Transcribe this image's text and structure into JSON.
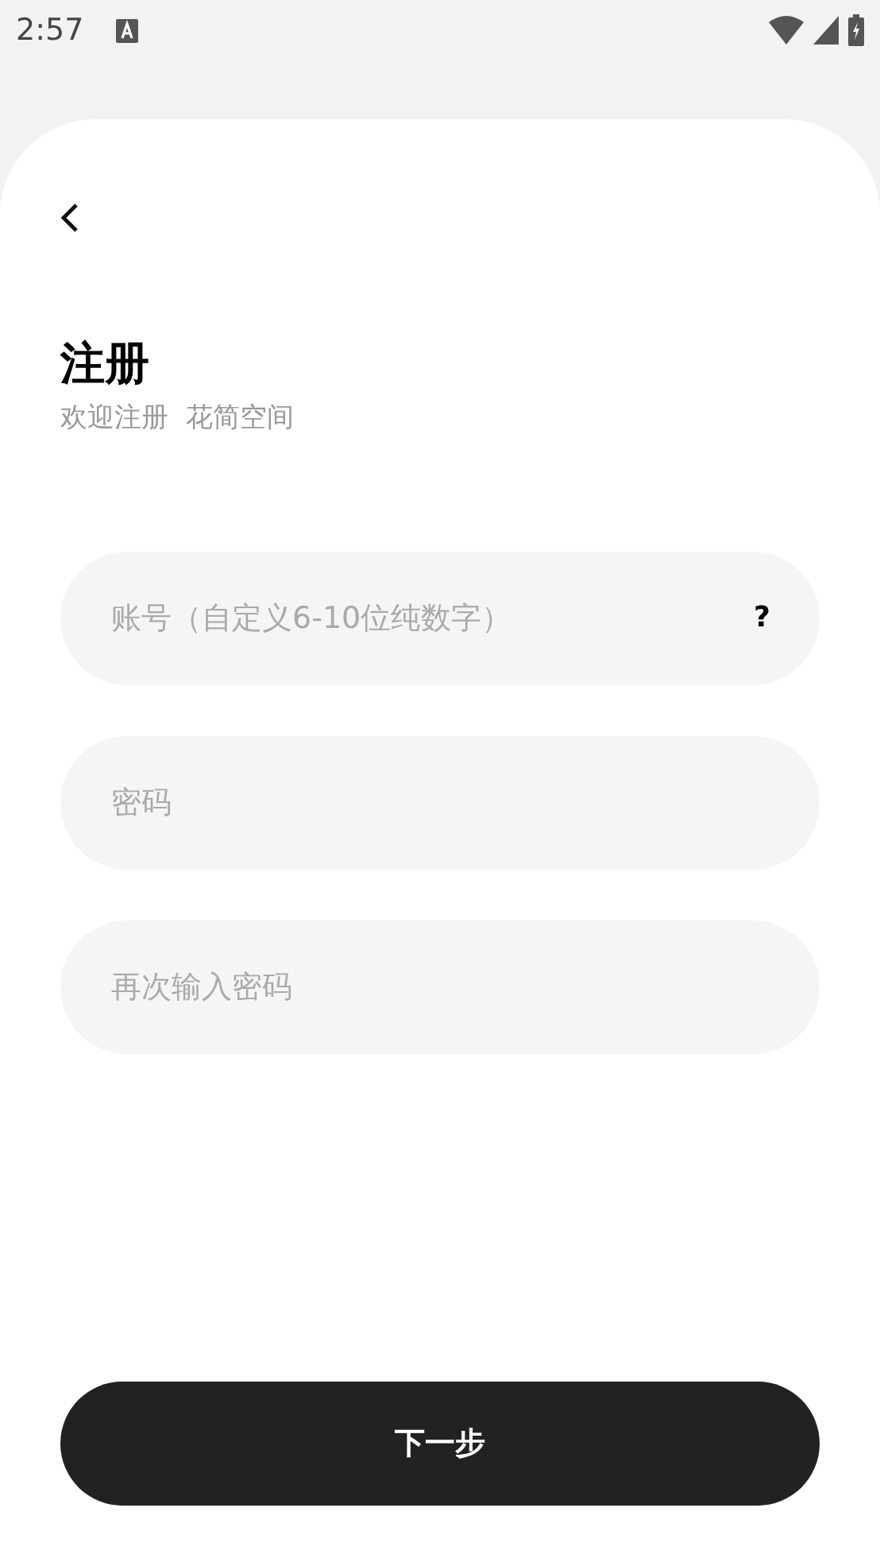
{
  "status_bar": {
    "time": "2:57"
  },
  "header": {
    "title": "注册",
    "subtitle": "欢迎注册  花简空间"
  },
  "fields": [
    {
      "placeholder": "账号（自定义6-10位纯数字）",
      "help": "?"
    },
    {
      "placeholder": "密码"
    },
    {
      "placeholder": "再次输入密码"
    }
  ],
  "next_button": {
    "label": "下一步"
  }
}
